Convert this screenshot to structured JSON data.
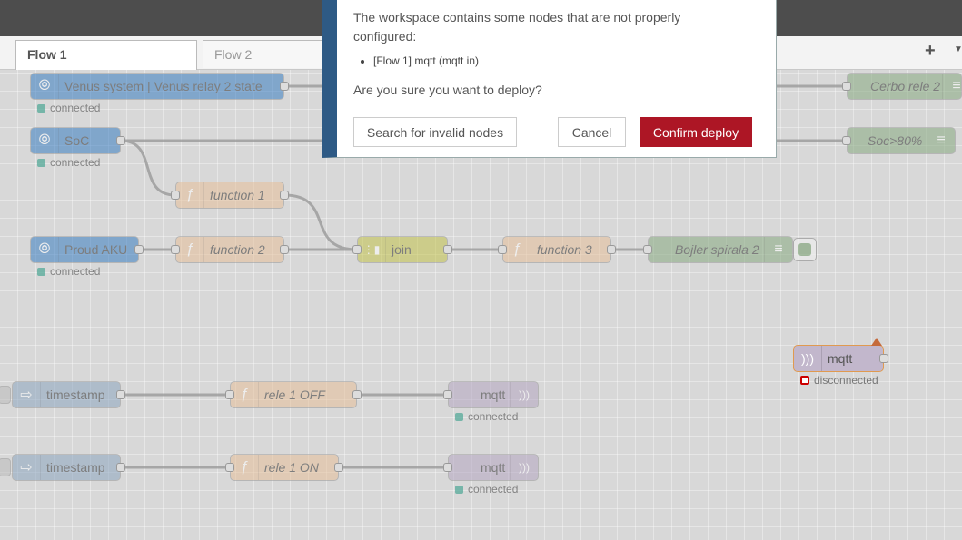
{
  "tabs": [
    {
      "label": "Flow 1",
      "active": true
    },
    {
      "label": "Flow 2",
      "active": false
    }
  ],
  "tab_add_label": "+",
  "tab_menu_label": "▼",
  "nodes": {
    "venus_system": "Venus system | Venus relay 2 state",
    "soc": "SoC",
    "function1": "function 1",
    "proud_aku": "Proud AKU",
    "function2": "function 2",
    "join": "join",
    "function3": "function 3",
    "bojler": "Bojler spirala 2",
    "cerbo": "Cerbo rele 2",
    "soc80": "Soc>80%",
    "mqtt_in": "mqtt",
    "timestamp1": "timestamp",
    "rele_off": "rele 1 OFF",
    "mqtt_out1": "mqtt",
    "timestamp2": "timestamp",
    "rele_on": "rele 1 ON",
    "mqtt_out2": "mqtt"
  },
  "status": {
    "connected": "connected",
    "disconnected": "disconnected"
  },
  "dialog": {
    "message": "The workspace contains some nodes that are not properly configured:",
    "invalid_nodes": [
      "[Flow 1] mqtt (mqtt in)"
    ],
    "question": "Are you sure you want to deploy?",
    "search_label": "Search for invalid nodes",
    "cancel_label": "Cancel",
    "confirm_label": "Confirm deploy"
  },
  "colors": {
    "confirm": "#ad1625",
    "dialog_accent": "#2e5a85",
    "victron_node": "#3a7ec2",
    "function_node": "#e7c09a",
    "join_node": "#d6dc7a",
    "mqtt_node": "#c2b7cc",
    "inject_node": "#a6bbcf",
    "debug_node": "#87a980"
  }
}
